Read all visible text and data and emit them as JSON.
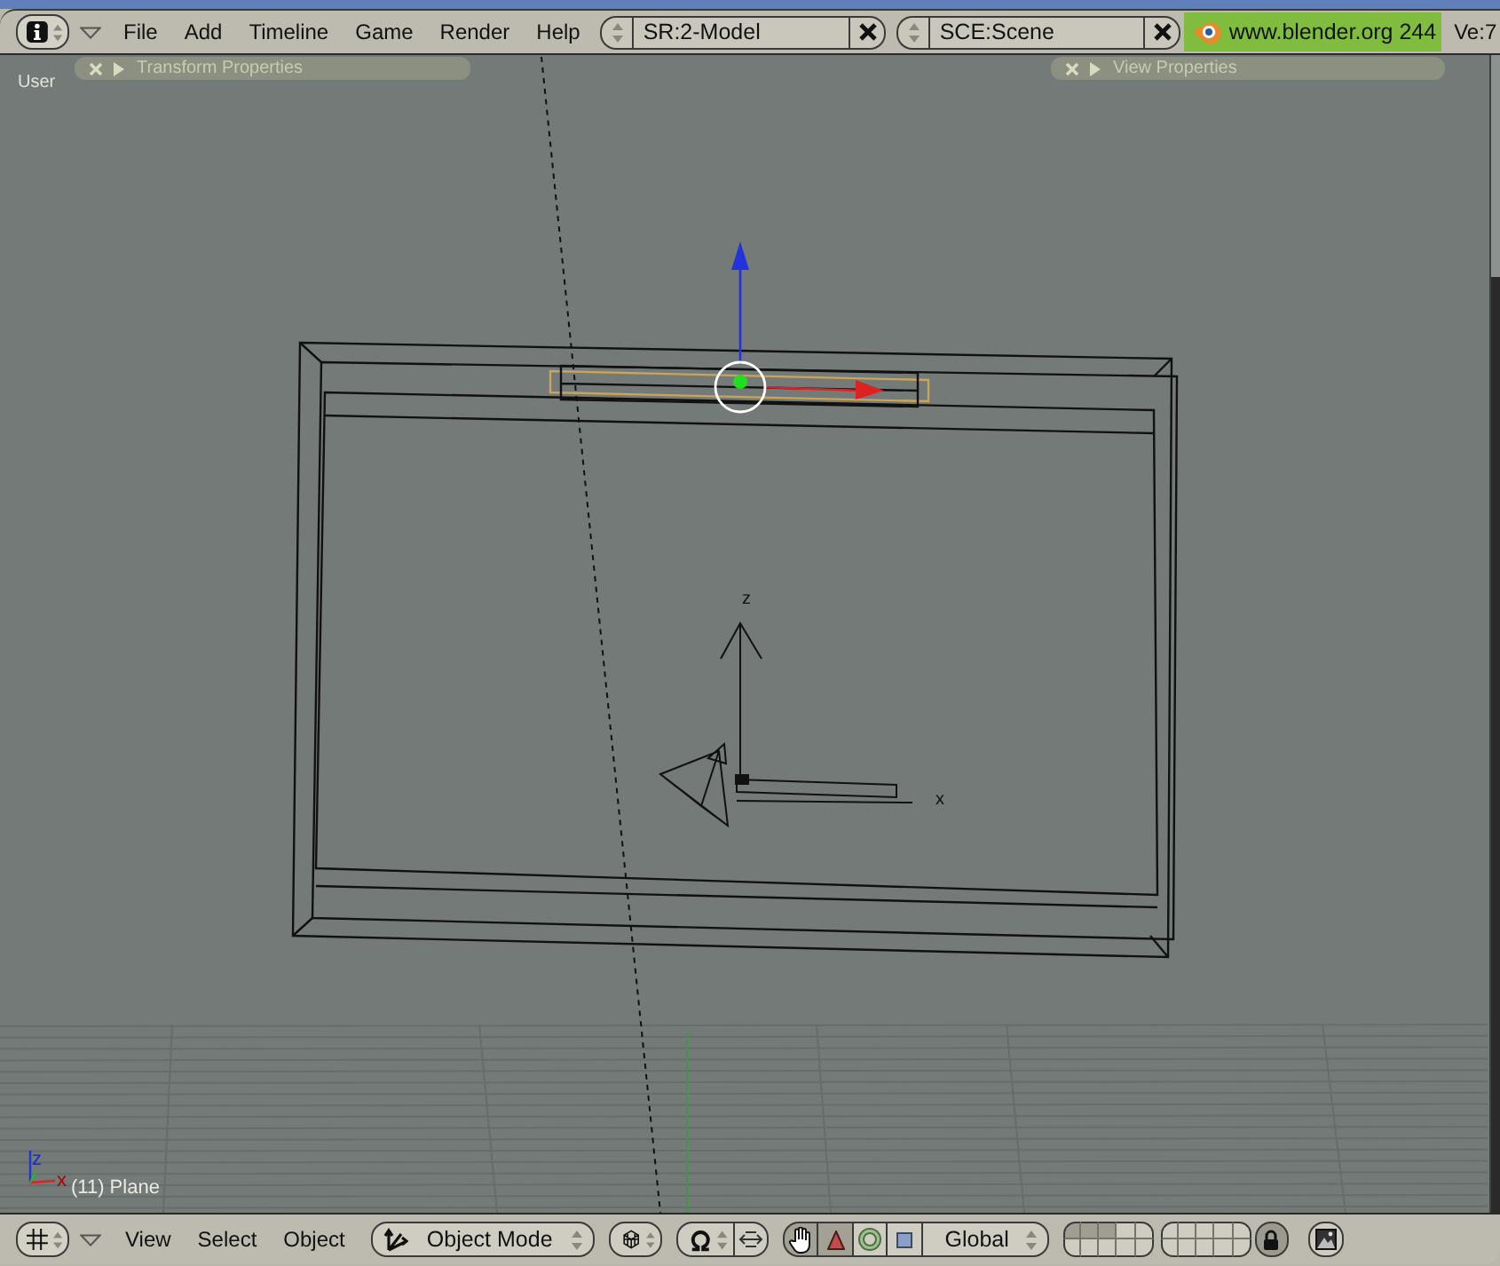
{
  "header": {
    "menus": [
      "File",
      "Add",
      "Timeline",
      "Game",
      "Render",
      "Help"
    ],
    "screen": {
      "value": "SR:2-Model"
    },
    "scene": {
      "value": "SCE:Scene"
    },
    "site_link": "www.blender.org 244",
    "stats": "Ve:7"
  },
  "viewport": {
    "view_name": "User",
    "panels": [
      {
        "title": "Transform Properties",
        "expanded": false
      },
      {
        "title": "View Properties",
        "expanded": false
      }
    ],
    "object_axis_labels": [
      "z",
      "x"
    ],
    "gizmo_labels": [
      "z",
      "x"
    ],
    "object_info": "(11) Plane"
  },
  "toolbar": {
    "menus": [
      "View",
      "Select",
      "Object"
    ],
    "mode": "Object Mode",
    "manipulators": [
      {
        "kind": "hand",
        "selected": true
      },
      {
        "kind": "translate",
        "selected": true
      },
      {
        "kind": "rotate",
        "selected": false
      },
      {
        "kind": "scale",
        "selected": false
      }
    ],
    "orientation": "Global",
    "layers": [
      {
        "on": true
      },
      {
        "on": true
      },
      {
        "on": true
      },
      {
        "on": false
      },
      {
        "on": false
      },
      {
        "on": false
      },
      {
        "on": false
      },
      {
        "on": false
      },
      {
        "on": false
      },
      {
        "on": false
      },
      {
        "on": false
      },
      {
        "on": false
      },
      {
        "on": false
      },
      {
        "on": false
      },
      {
        "on": false
      },
      {
        "on": false
      },
      {
        "on": false
      },
      {
        "on": false
      },
      {
        "on": false
      },
      {
        "on": false
      }
    ],
    "lock": {
      "on": true
    }
  }
}
